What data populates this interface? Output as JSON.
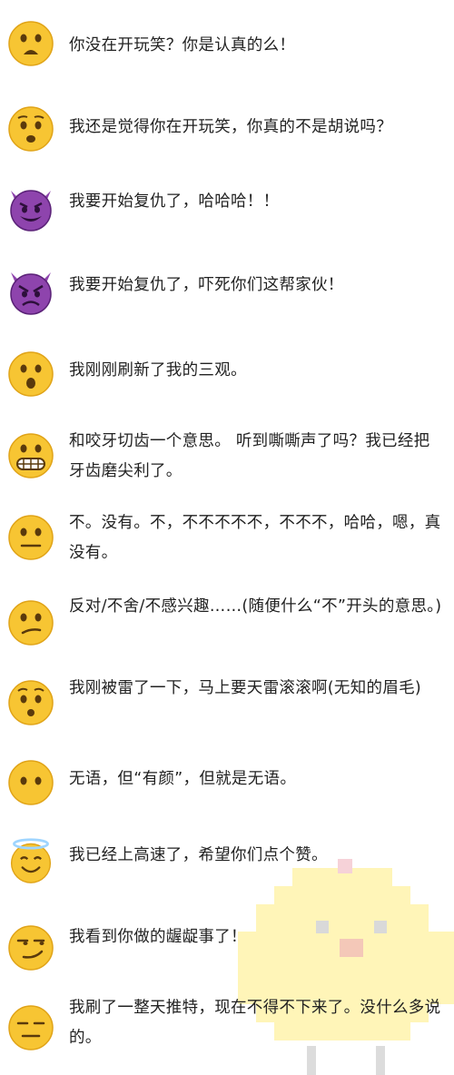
{
  "items": [
    {
      "icon": "frowning-open-mouth-face-icon",
      "text": "你没在开玩笑？你是认真的么！"
    },
    {
      "icon": "hushed-face-icon",
      "text": "我还是觉得你在开玩笑，你真的不是胡说吗？"
    },
    {
      "icon": "smiling-imp-icon",
      "text": "我要开始复仇了，哈哈哈！！"
    },
    {
      "icon": "angry-imp-icon",
      "text": "我要开始复仇了，吓死你们这帮家伙！"
    },
    {
      "icon": "astonished-face-icon",
      "text": "我刚刚刷新了我的三观。"
    },
    {
      "icon": "grimacing-face-icon",
      "text": "和咬牙切齿一个意思。 听到嘶嘶声了吗？我已经把牙齿磨尖利了。"
    },
    {
      "icon": "neutral-face-icon",
      "text": "不。没有。不，不不不不不，不不不，哈哈，嗯，真没有。"
    },
    {
      "icon": "confused-face-icon",
      "text": "反对/不舍/不感兴趣……(随便什么“不”开头的意思。)"
    },
    {
      "icon": "hushed-raised-brows-face-icon",
      "text": "我刚被雷了一下，马上要天雷滚滚啊(无知的眉毛)"
    },
    {
      "icon": "face-without-mouth-icon",
      "text": "无语，但“有颜”，但就是无语。"
    },
    {
      "icon": "smiling-face-with-halo-icon",
      "text": "我已经上高速了，希望你们点个赞。"
    },
    {
      "icon": "smirking-face-icon",
      "text": "我看到你做的龌龊事了！"
    },
    {
      "icon": "expressionless-face-icon",
      "text": "我刷了一整天推特，现在不得不下来了。没什么多说的。"
    }
  ],
  "colors": {
    "face": "#f7c533",
    "face_edge": "#e0a317",
    "features": "#5a3a0c",
    "imp": "#8e44ad",
    "imp_dark": "#5b2278",
    "halo": "#9fd5ff",
    "chick": "#fff3b0",
    "chick_beak": "#f7c9b4"
  }
}
